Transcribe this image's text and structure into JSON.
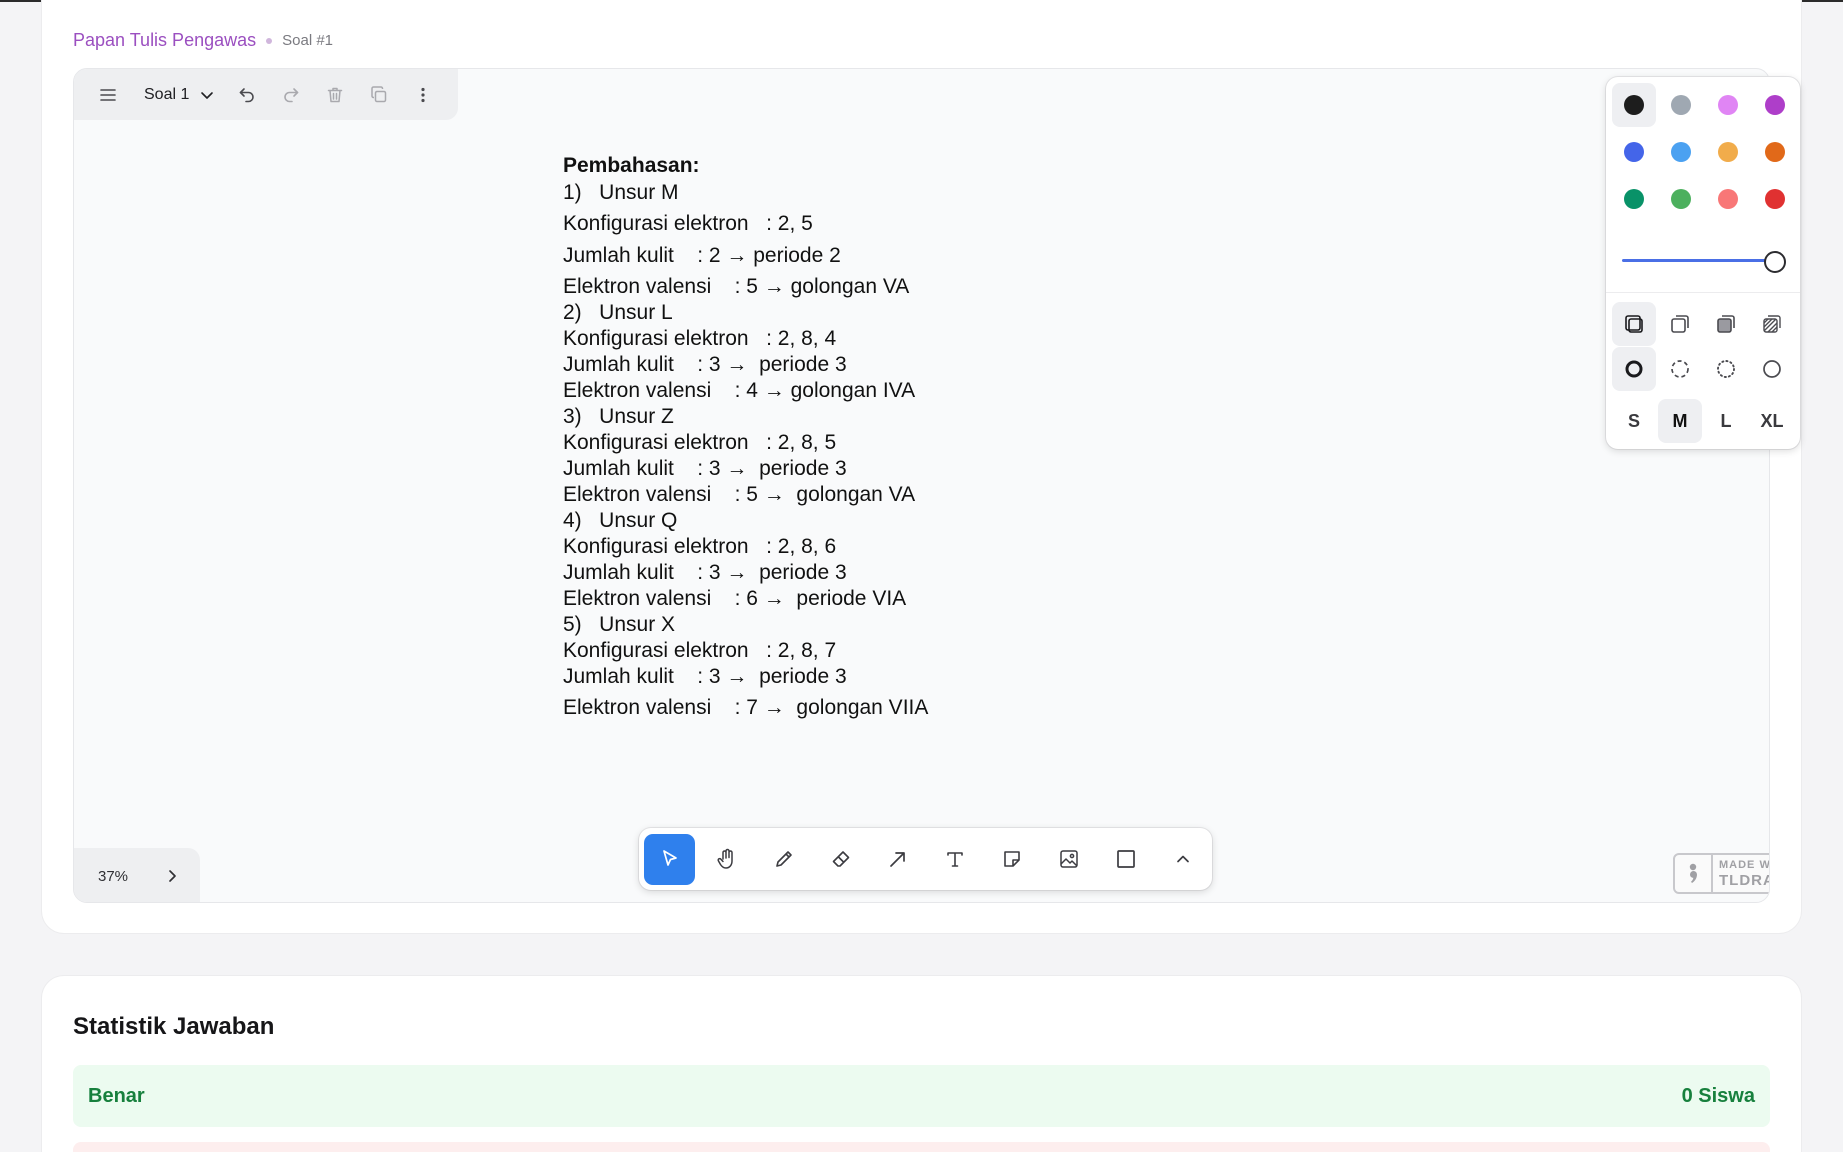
{
  "breadcrumb": {
    "title": "Papan Tulis Pengawas",
    "current": "Soal #1"
  },
  "menubar": {
    "page_label": "Soal 1"
  },
  "canvas": {
    "lines": [
      "Pembahasan:",
      "1)   Unsur M",
      "Konfigurasi elektron   : 2, 5",
      "Jumlah kulit    : 2 → periode 2",
      "Elektron valensi    : 5 → golongan VA",
      "2)   Unsur L",
      "Konfigurasi elektron   : 2, 8, 4",
      "Jumlah kulit    : 3 →  periode 3",
      "Elektron valensi    : 4 → golongan IVA",
      "3)   Unsur Z",
      "Konfigurasi elektron   : 2, 8, 5",
      "Jumlah kulit    : 3 →  periode 3",
      "Elektron valensi    : 5 →  golongan VA",
      "4)   Unsur Q",
      "Konfigurasi elektron   : 2, 8, 6",
      "Jumlah kulit    : 3 →  periode 3",
      "Elektron valensi    : 6 →  periode VIA",
      "5)   Unsur X",
      "Konfigurasi elektron   : 2, 8, 7",
      "Jumlah kulit    : 3 →  periode 3",
      "Elektron valensi    : 7 →  golongan VIIA"
    ]
  },
  "style_panel": {
    "colors": [
      "#1d1d1d",
      "#9fa8b2",
      "#e085f4",
      "#ae3ec9",
      "#4465e9",
      "#4ba1f1",
      "#f1ac4b",
      "#e16919",
      "#099268",
      "#4cb05e",
      "#f87777",
      "#e03131"
    ],
    "selected_color": "#1d1d1d",
    "opacity": 1,
    "sizes": [
      "S",
      "M",
      "L",
      "XL"
    ],
    "selected_size": "M"
  },
  "zoom": {
    "label": "37%"
  },
  "toolbar": {
    "selected_tool": "select"
  },
  "watermark": {
    "line1": "MADE WITH",
    "line2": "TLDRAW"
  },
  "stats": {
    "title": "Statistik Jawaban",
    "benar_label": "Benar",
    "benar_value": "0 Siswa"
  }
}
